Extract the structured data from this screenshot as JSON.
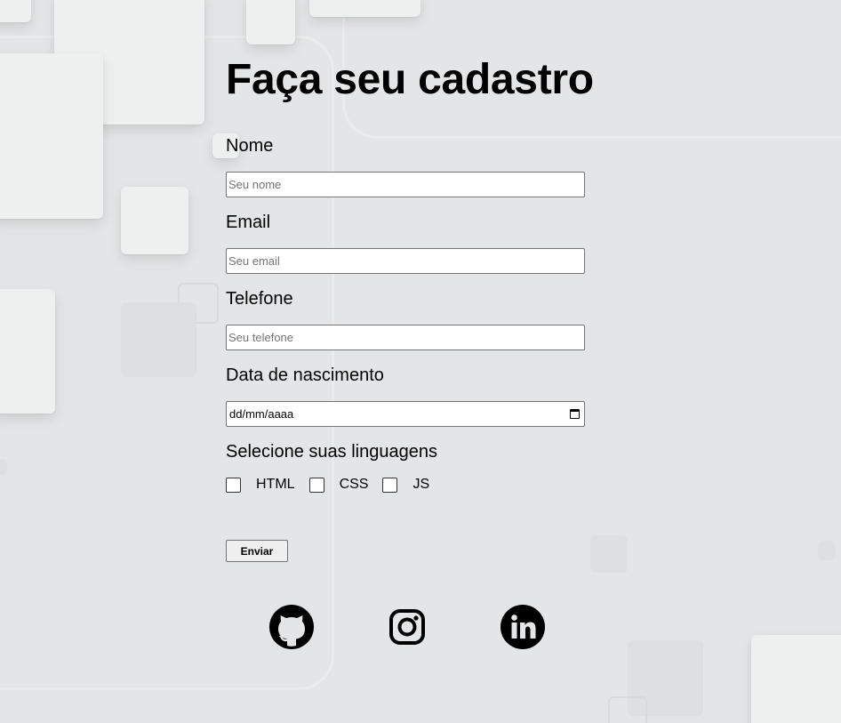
{
  "form": {
    "title": "Faça seu cadastro",
    "fields": [
      {
        "label": "Nome",
        "placeholder": "Seu nome"
      },
      {
        "label": "Email",
        "placeholder": "Seu email"
      },
      {
        "label": "Telefone",
        "placeholder": "Seu telefone"
      },
      {
        "label": "Data de nascimento",
        "value": "dd/mm/aaaa"
      }
    ],
    "languages": {
      "label": "Selecione suas linguagens",
      "options": [
        "HTML",
        "CSS",
        "JS"
      ]
    },
    "submit_label": "Enviar"
  },
  "social": [
    {
      "icon": "github-icon"
    },
    {
      "icon": "instagram-icon"
    },
    {
      "icon": "linkedin-icon"
    }
  ],
  "colors": {
    "background": "#e4e5e6",
    "text": "#000000"
  }
}
